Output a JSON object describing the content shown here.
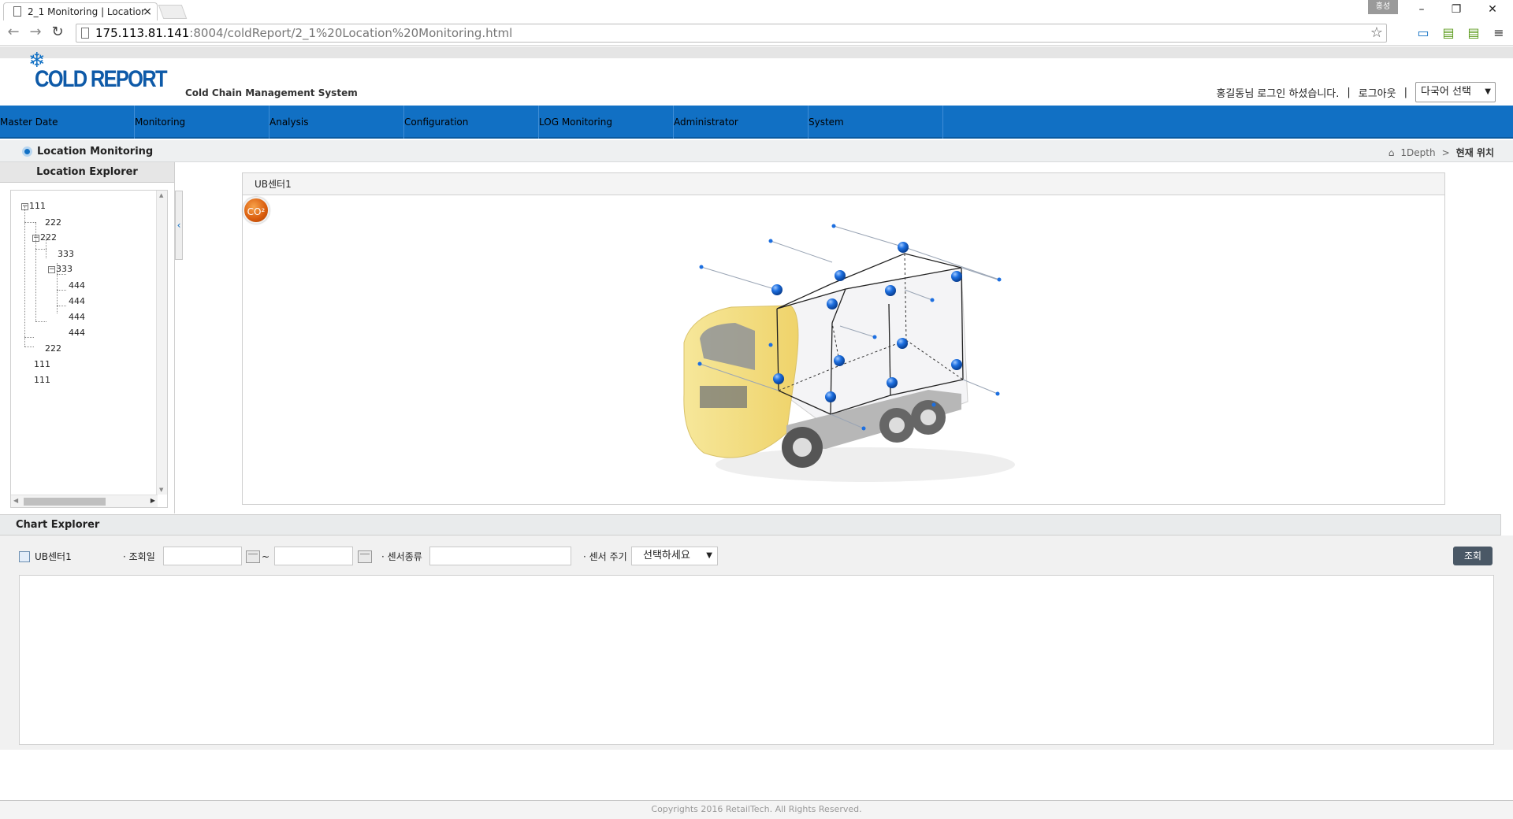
{
  "browser": {
    "tab_title": "2_1 Monitoring | Locatior",
    "tab_close": "×",
    "url_host": "175.113.81.141",
    "url_path": ":8004/coldReport/2_1%20Location%20Monitoring.html",
    "window_badge": "홍성",
    "win_min": "–",
    "win_max": "❐",
    "win_close": "✕",
    "back": "←",
    "forward": "→",
    "reload": "↻",
    "star": "☆",
    "menu": "≡"
  },
  "header": {
    "logo_text": "COLD REPORT",
    "subtitle": "Cold Chain Management System",
    "login_msg": "홍길동님 로그인 하셨습니다.",
    "separator": "|",
    "logout": "로그아웃",
    "language_select": "다국어 선택",
    "select_arrow": "▼"
  },
  "menu": [
    "Master Date",
    "Monitoring",
    "Analysis",
    "Configuration",
    "LOG Monitoring",
    "Administrator",
    "System"
  ],
  "page": {
    "title": "Location Monitoring",
    "breadcrumb_home": "1Depth",
    "breadcrumb_sep": ">",
    "breadcrumb_current": "현재 위치"
  },
  "explorer": {
    "title": "Location Explorer",
    "collapse": "‹",
    "tree": [
      {
        "label": "111",
        "expander": "−"
      },
      {
        "label": "222",
        "expander": ""
      },
      {
        "label": "222",
        "expander": "−"
      },
      {
        "label": "333",
        "expander": ""
      },
      {
        "label": "333",
        "expander": "−"
      },
      {
        "label": "444",
        "expander": ""
      },
      {
        "label": "444",
        "expander": ""
      },
      {
        "label": "444",
        "expander": ""
      },
      {
        "label": "444",
        "expander": ""
      },
      {
        "label": "222",
        "expander": ""
      },
      {
        "label": "111",
        "expander": ""
      },
      {
        "label": "111",
        "expander": ""
      }
    ]
  },
  "canvas": {
    "title": "UB센터1",
    "co2_badge": "CO²"
  },
  "chart_explorer": {
    "title": "Chart Explorer",
    "location": "UB센터1",
    "date_label": "· 조회일",
    "range_sep": "~",
    "sensor_type_label": "· 센서종류",
    "sensor_cycle_label": "· 센서 주기",
    "cycle_select": "선택하세요",
    "select_arrow": "▼",
    "search_button": "조회",
    "date_from": "",
    "date_to": "",
    "sensor_type": ""
  },
  "footer": {
    "copyright": "Copyrights 2016 RetailTech. All Rights Reserved."
  }
}
